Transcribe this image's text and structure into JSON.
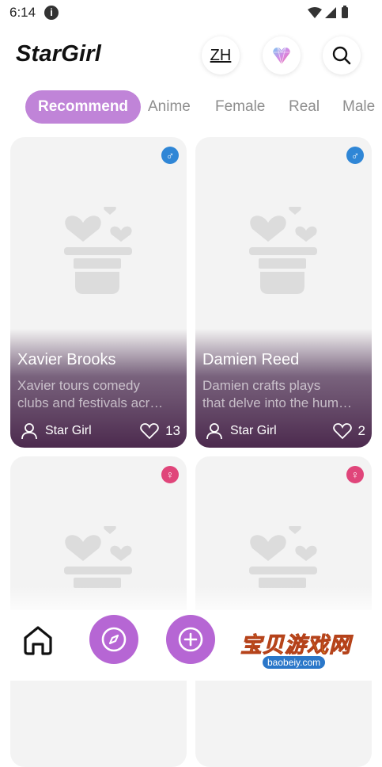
{
  "status_bar": {
    "time": "6:14",
    "info_icon": "info-icon"
  },
  "header": {
    "logo": "StarGirl",
    "language": "ZH",
    "gem_icon": "diamond-icon",
    "search_icon": "search-icon"
  },
  "tabs": [
    {
      "label": "Recommend",
      "active": true
    },
    {
      "label": "Anime"
    },
    {
      "label": "Female"
    },
    {
      "label": "Real"
    },
    {
      "label": "Male"
    }
  ],
  "cards": [
    {
      "name": "Xavier Brooks",
      "gender": "male",
      "desc_line1": "Xavier tours comedy",
      "desc_line2": "clubs and festivals acr…",
      "author": "Star Girl",
      "likes": "13"
    },
    {
      "name": "Damien Reed",
      "gender": "male",
      "desc_line1": "Damien crafts plays",
      "desc_line2": "that delve into the hum…",
      "author": "Star Girl",
      "likes": "2"
    },
    {
      "gender": "female"
    },
    {
      "gender": "female"
    }
  ],
  "watermark": {
    "text": "宝贝游戏网",
    "url": "baobeiy.com"
  },
  "colors": {
    "accent": "#c084d8",
    "nav_button": "#b666d4",
    "male": "#2f86d6",
    "female": "#e0457a"
  }
}
